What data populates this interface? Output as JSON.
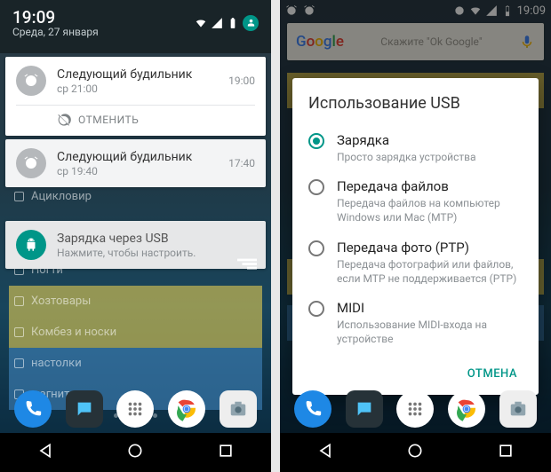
{
  "left": {
    "status": {
      "time": "19:09",
      "date": "Среда, 27 января"
    },
    "notifications": [
      {
        "title": "Следующий будильник",
        "sub": "ср 21:00",
        "time": "19:00",
        "action": "ОТМЕНИТЬ"
      },
      {
        "title": "Следующий будильник",
        "sub": "ср 19:40",
        "time": "17:40"
      },
      {
        "title": "Зарядка через USB",
        "sub": "Нажмите, чтобы настроить."
      }
    ],
    "bg_items": [
      "Ацикловир",
      "Ногти",
      "Хозтовары",
      "Комбез и носки",
      "настолки",
      "магниты"
    ]
  },
  "right": {
    "status_time": "19:09",
    "search_placeholder": "Скажите \"Ok Google\"",
    "dialog": {
      "title": "Использование USB",
      "options": [
        {
          "label": "Зарядка",
          "desc": "Просто зарядка устройства",
          "selected": true
        },
        {
          "label": "Передача файлов",
          "desc": "Передача файлов на компьютер Windows или Mac (MTP)",
          "selected": false
        },
        {
          "label": "Передача фото (PTP)",
          "desc": "Передача фотографий или файлов, если MTP не поддерживается (PTP)",
          "selected": false
        },
        {
          "label": "MIDI",
          "desc": "Использование MIDI-входа на устройстве",
          "selected": false
        }
      ],
      "cancel": "ОТМЕНА"
    }
  }
}
